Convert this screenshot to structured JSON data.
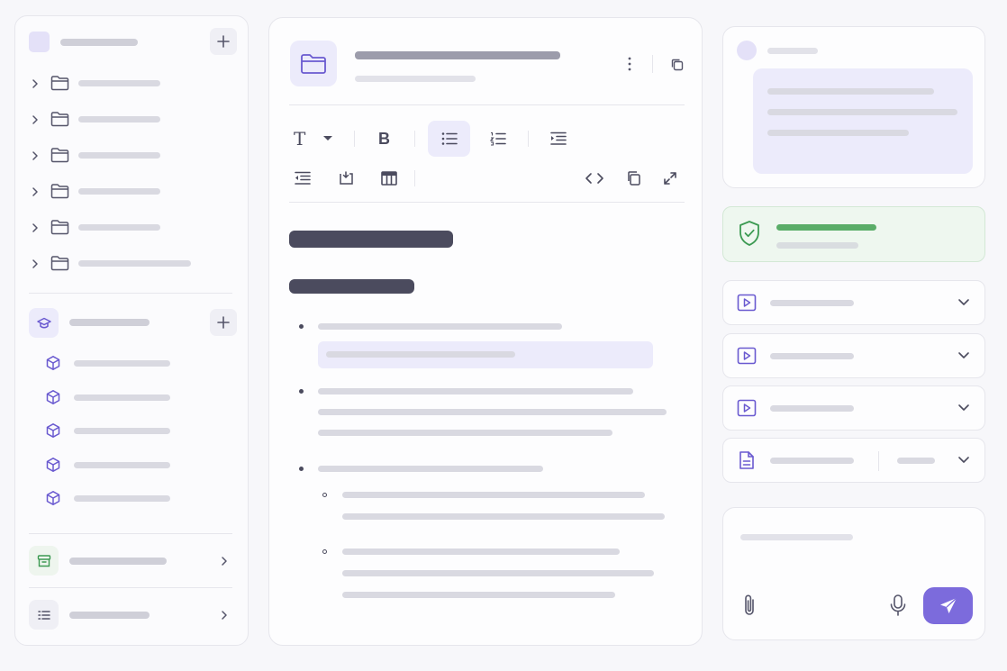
{
  "colors": {
    "accent": "#7c6bdc",
    "accent_soft": "#ecebfb",
    "success": "#3c9a52",
    "success_soft": "#eef7ef",
    "heading": "#4b4b5e"
  },
  "sidebar": {
    "workspace_add_icon": "plus-icon",
    "folders": [
      {
        "icon": "folder-icon"
      },
      {
        "icon": "folder-icon"
      },
      {
        "icon": "folder-icon"
      },
      {
        "icon": "folder-icon"
      },
      {
        "icon": "folder-icon"
      },
      {
        "icon": "folder-icon"
      }
    ],
    "courses_icon": "graduation-cap-icon",
    "modules": [
      {
        "icon": "cube-icon"
      },
      {
        "icon": "cube-icon"
      },
      {
        "icon": "cube-icon"
      },
      {
        "icon": "cube-icon"
      },
      {
        "icon": "cube-icon"
      }
    ],
    "archive_icon": "archive-icon",
    "list_icon": "list-icon"
  },
  "editor": {
    "header_icon": "folder-icon",
    "toolbar": [
      "text-format-icon",
      "bold-icon",
      "bullet-list-icon",
      "numbered-list-icon",
      "indent-icon",
      "outdent-icon",
      "insert-block-icon",
      "table-icon",
      "code-icon",
      "copy-icon",
      "expand-icon"
    ],
    "bold_glyph": "B",
    "text_glyph": "T"
  },
  "right_panel": {
    "status_icon": "shield-check-icon",
    "media_icon": "play-icon",
    "doc_icon": "document-icon",
    "composer_icons": [
      "paperclip-icon",
      "microphone-icon",
      "send-icon"
    ]
  }
}
